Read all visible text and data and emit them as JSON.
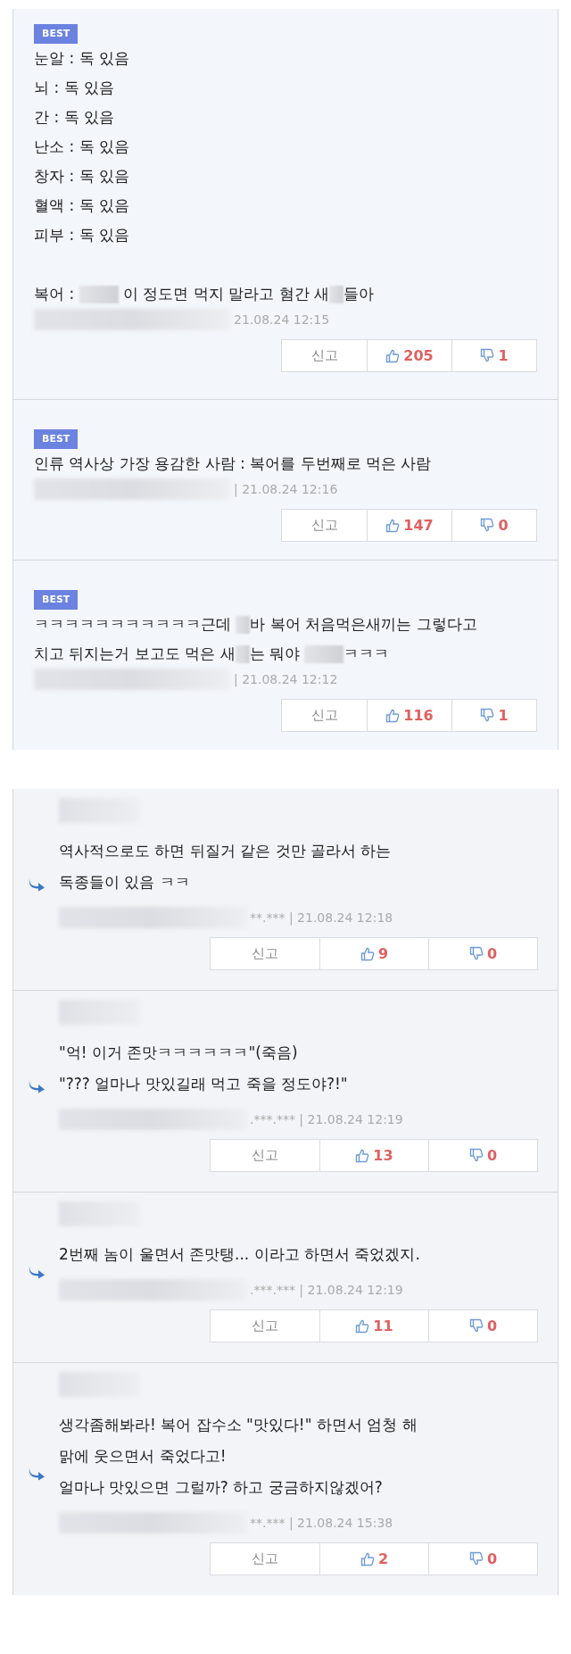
{
  "panels": [
    {
      "kind": "best",
      "comments": [
        {
          "badge": "BEST",
          "paragraphs": [
            [
              [
                "눈알 : 독 있음"
              ],
              [
                "뇌 : 독 있음"
              ],
              [
                "간 : 독 있음"
              ],
              [
                "난소 : 독 있음"
              ],
              [
                "창자 : 독 있음"
              ],
              [
                "혈액 : 독 있음"
              ],
              [
                "피부 : 독 있음"
              ]
            ],
            [
              [
                "복어 : ",
                {
                  "kind": "redacted",
                  "wide": true
                },
                " 이 정도면 먹지 말라고 혐간 새",
                {
                  "kind": "redacted",
                  "wide": false
                },
                "들아"
              ]
            ]
          ],
          "meta": "21.08.24 12:15",
          "actions": {
            "report": "신고",
            "likes": "205",
            "dislikes": "1"
          }
        },
        {
          "badge": "BEST",
          "paragraphs": [
            [
              [
                "인류 역사상 가장 용감한 사람 : 복어를 두번째로 먹은 사람"
              ]
            ]
          ],
          "meta": "| 21.08.24 12:16",
          "actions": {
            "report": "신고",
            "likes": "147",
            "dislikes": "0"
          }
        },
        {
          "badge": "BEST",
          "paragraphs": [
            [
              [
                "ㅋㅋㅋㅋㅋㅋㅋㅋㅋㅋㅋ근데 ",
                {
                  "kind": "redacted",
                  "wide": false
                },
                "바 복어 처음먹은새끼는 그렇다고"
              ],
              [
                "치고 뒤지는거 보고도 먹은 새",
                {
                  "kind": "redacted",
                  "wide": false
                },
                "는 뭐야 ",
                {
                  "kind": "redacted",
                  "wide": true
                },
                "ㅋㅋㅋ"
              ]
            ]
          ],
          "meta": "| 21.08.24 12:12",
          "actions": {
            "report": "신고",
            "likes": "116",
            "dislikes": "1"
          }
        }
      ]
    },
    {
      "kind": "reply",
      "comments": [
        {
          "paragraphs": [
            [
              [
                "역사적으로도 하면 뒤질거 같은 것만 골라서 하는"
              ],
              [
                "독종들이 있음 ㅋㅋ"
              ]
            ]
          ],
          "meta": "**.*** | 21.08.24 12:18",
          "actions": {
            "report": "신고",
            "likes": "9",
            "dislikes": "0"
          }
        },
        {
          "paragraphs": [
            [
              [
                "\"억! 이거 존맛ㅋㅋㅋㅋㅋㅋ\"(죽음)"
              ],
              [
                "\"??? 얼마나 맛있길래 먹고 죽을 정도야?!\""
              ]
            ]
          ],
          "meta": ".***.*** | 21.08.24 12:19",
          "actions": {
            "report": "신고",
            "likes": "13",
            "dislikes": "0"
          }
        },
        {
          "paragraphs": [
            [
              [
                "2번째 놈이 울면서 존맛탱... 이라고 하면서 죽었겠지."
              ]
            ]
          ],
          "meta": ".***.*** | 21.08.24 12:19",
          "actions": {
            "report": "신고",
            "likes": "11",
            "dislikes": "0"
          }
        },
        {
          "paragraphs": [
            [
              [
                "생각좀해봐라! 복어 잡수소 \"맛있다!\" 하면서 엄청 해"
              ],
              [
                "맑에 웃으면서 죽었다고!"
              ],
              [
                "얼마나 맛있으면 그럴까? 하고 궁금하지않겠어?"
              ]
            ]
          ],
          "meta": "**.*** | 21.08.24 15:38",
          "actions": {
            "report": "신고",
            "likes": "2",
            "dislikes": "0"
          }
        }
      ]
    }
  ]
}
